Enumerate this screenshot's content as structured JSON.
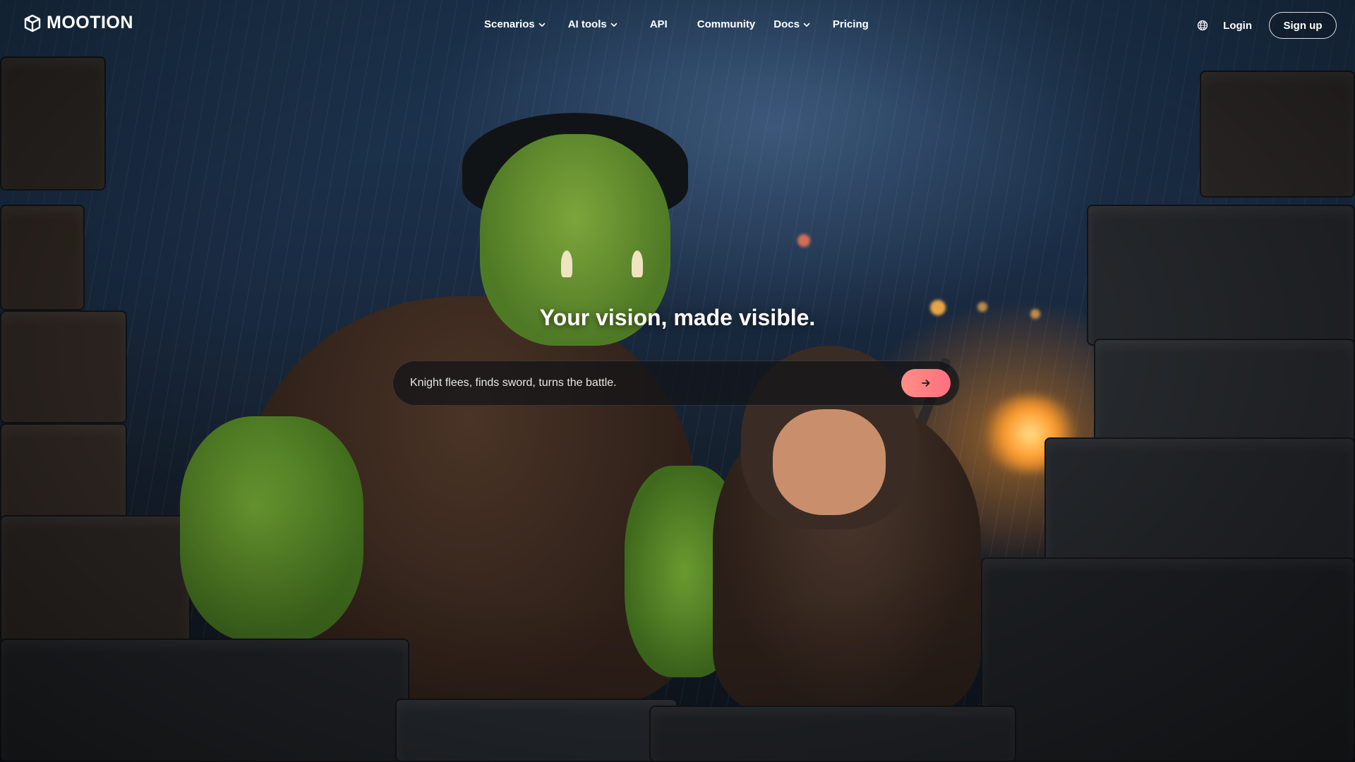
{
  "brand": {
    "name": "MOOTION",
    "logo_icon": "mootion-cube-icon"
  },
  "nav": {
    "items": [
      {
        "label": "Scenarios",
        "has_dropdown": true
      },
      {
        "label": "AI tools",
        "has_dropdown": true
      },
      {
        "label": "API",
        "has_dropdown": false
      },
      {
        "label": "Community",
        "has_dropdown": false
      },
      {
        "label": "Docs",
        "has_dropdown": true
      },
      {
        "label": "Pricing",
        "has_dropdown": false
      }
    ],
    "language_icon": "globe-icon",
    "login_label": "Login",
    "signup_label": "Sign up"
  },
  "hero": {
    "headline": "Your vision, made visible.",
    "prompt_value": "Knight flees, finds sword, turns the battle.",
    "submit_icon": "arrow-right-icon",
    "submit_color": "#ff7a82",
    "background_image": "fantasy-orc-and-hooded-child-in-rainy-ruins"
  }
}
